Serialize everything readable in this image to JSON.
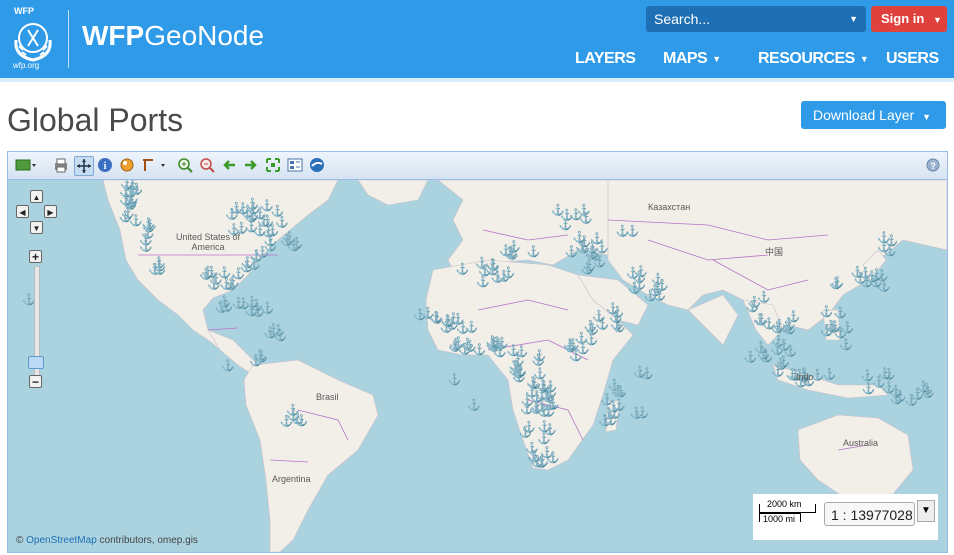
{
  "header": {
    "logo_top": "WFP",
    "logo_bottom": "wfp.org",
    "brand_bold": "WFP",
    "brand_rest": "GeoNode",
    "search_placeholder": "Search...",
    "signin_label": "Sign in",
    "nav": [
      {
        "label": "LAYERS",
        "dropdown": false
      },
      {
        "label": "MAPS",
        "dropdown": true
      },
      {
        "label": "RESOURCES",
        "dropdown": true
      },
      {
        "label": "USERS",
        "dropdown": false
      }
    ]
  },
  "page": {
    "title": "Global Ports",
    "download_label": "Download Layer"
  },
  "toolbar_icons": [
    "layer-switcher-icon",
    "print-icon",
    "pan-icon",
    "info-icon",
    "measure-icon",
    "query-icon",
    "zoom-in-icon",
    "zoom-out-icon",
    "previous-extent-icon",
    "next-extent-icon",
    "zoom-to-max-extent-icon",
    "legend-icon",
    "google-earth-icon",
    "help-icon"
  ],
  "map": {
    "labels": {
      "usa": "United States of America",
      "kazakhstan": "Казахстан",
      "china": "中国",
      "brasil": "Brasil",
      "argentina": "Argentina",
      "australia": "Australia",
      "indonesia": "Indo"
    },
    "scale": {
      "km": "2000 km",
      "mi": "1000 mi",
      "ratio": "1 : 13977028"
    },
    "attribution_prefix": "© ",
    "attribution_link": "OpenStreetMap",
    "attribution_suffix": " contributors, omep.gis",
    "colors": {
      "ocean": "#aad3df",
      "land": "#f2efe9",
      "border": "#b673c6",
      "port": "#1a5fa8"
    }
  }
}
